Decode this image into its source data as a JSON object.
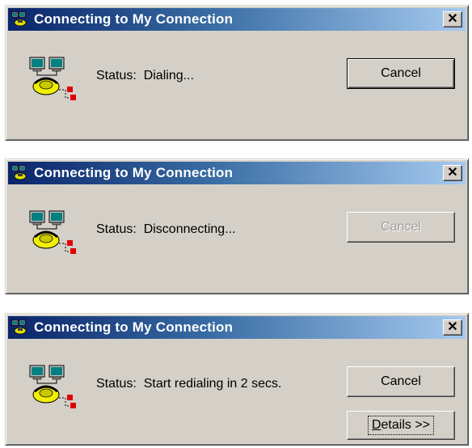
{
  "dialogs": [
    {
      "title": "Connecting to My Connection",
      "status": "Status:  Dialing...",
      "cancel_label": "Cancel",
      "cancel_state": "default"
    },
    {
      "title": "Connecting to My Connection",
      "status": "Status:  Disconnecting...",
      "cancel_label": "Cancel",
      "cancel_state": "disabled"
    },
    {
      "title": "Connecting to My Connection",
      "status": "Status:  Start redialing in 2 secs.",
      "cancel_label": "Cancel",
      "cancel_state": "normal",
      "details_mnemonic": "D",
      "details_rest": "etails >>"
    }
  ],
  "icons": {
    "title": "network-connections-icon",
    "body": "dialup-connection-icon",
    "close": "close-icon"
  },
  "colors": {
    "dialog_face": "#d4d0c8",
    "titlebar_start": "#0a246a",
    "titlebar_end": "#a6caf0",
    "disabled_text": "#a0a0a0"
  }
}
